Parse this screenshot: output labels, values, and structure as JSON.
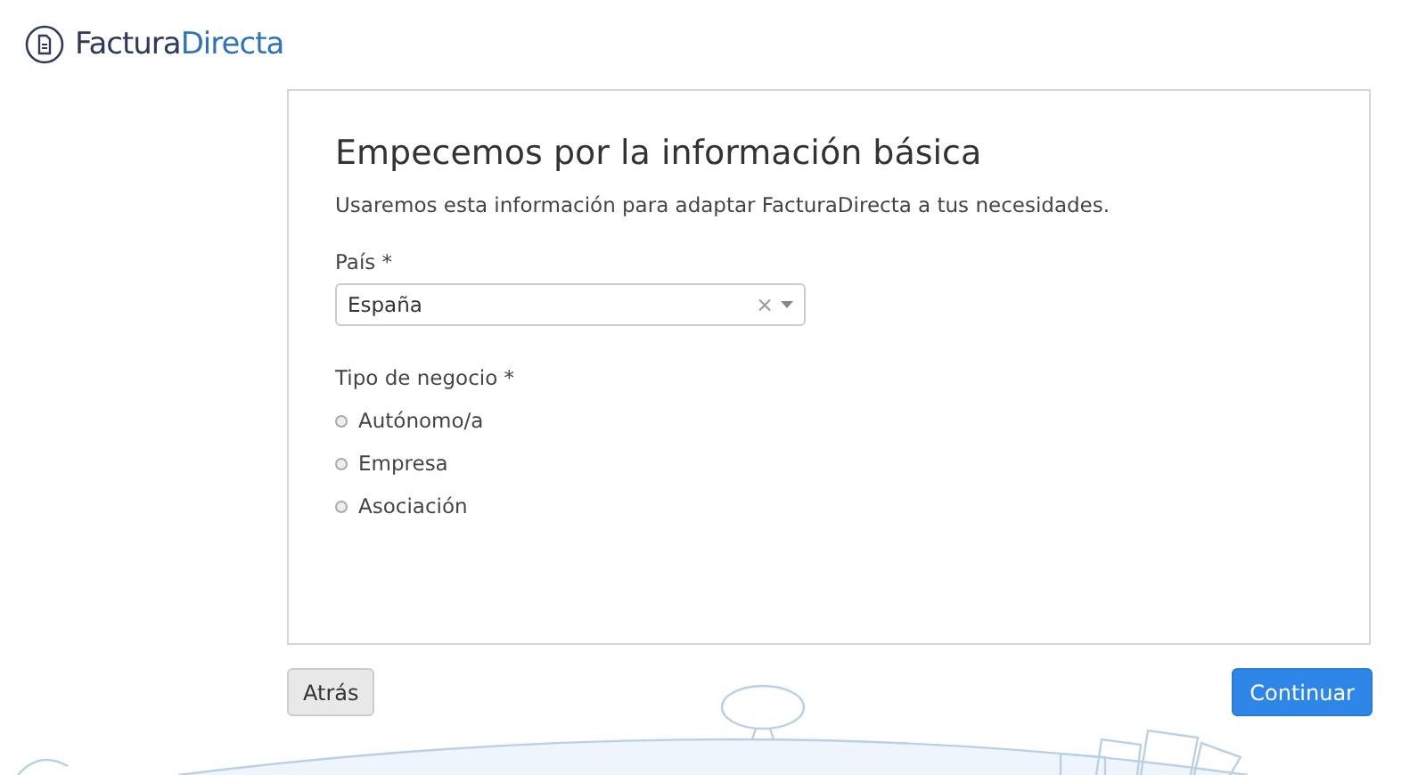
{
  "logo": {
    "first": "Factura",
    "second": "Directa"
  },
  "card": {
    "title": "Empecemos por la información básica",
    "subtitle": "Usaremos esta información para adaptar FacturaDirecta a tus necesidades.",
    "country": {
      "label": "País *",
      "value": "España",
      "clear": "×"
    },
    "business_type": {
      "label": "Tipo de negocio *",
      "options": [
        {
          "label": "Autónomo/a",
          "selected": false
        },
        {
          "label": "Empresa",
          "selected": false
        },
        {
          "label": "Asociación",
          "selected": false
        }
      ]
    }
  },
  "buttons": {
    "back": "Atrás",
    "continue": "Continuar"
  }
}
